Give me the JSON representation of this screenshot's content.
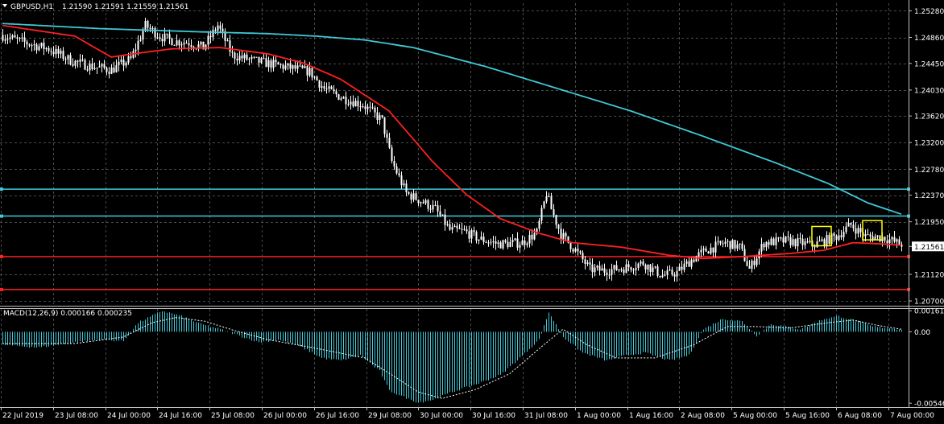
{
  "header": {
    "symbol": "GBPUSD,H1",
    "ohlc": "1.21590 1.21591 1.21559 1.21561"
  },
  "macd_header": "MACD(12,26,9) 0.000166 0.000235",
  "colors": {
    "background": "#000000",
    "grid": "#4a4a4a",
    "candle": "#ffffff",
    "ma_fast": "#ff2020",
    "ma_slow": "#40c8d8",
    "hline_cyan": "#40c8d8",
    "hline_red": "#ff2020",
    "macd_hist": "#40c8d8",
    "macd_signal": "#ffffff",
    "highlight": "#ffff00"
  },
  "chart_data": [
    {
      "type": "candlestick",
      "title": "GBPUSD,H1",
      "price_labels": [
        "1.25280",
        "1.24860",
        "1.24450",
        "1.24030",
        "1.23620",
        "1.23200",
        "1.22780",
        "1.22370",
        "1.21950",
        "1.21561",
        "1.21120",
        "1.20700"
      ],
      "current_price": "1.21561",
      "ylim": [
        1.2065,
        1.254
      ],
      "x_tick_labels": [
        "22 Jul 2019",
        "23 Jul 08:00",
        "24 Jul 00:00",
        "24 Jul 16:00",
        "25 Jul 08:00",
        "26 Jul 00:00",
        "26 Jul 16:00",
        "29 Jul 08:00",
        "30 Jul 00:00",
        "30 Jul 16:00",
        "31 Jul 08:00",
        "1 Aug 00:00",
        "1 Aug 16:00",
        "2 Aug 08:00",
        "5 Aug 00:00",
        "5 Aug 16:00",
        "6 Aug 08:00",
        "7 Aug 00:00"
      ],
      "anchors": [
        [
          0,
          1.249
        ],
        [
          10,
          1.2478
        ],
        [
          20,
          1.2468
        ],
        [
          30,
          1.2448
        ],
        [
          38,
          1.244
        ],
        [
          46,
          1.2435
        ],
        [
          54,
          1.2452
        ],
        [
          60,
          1.2505
        ],
        [
          66,
          1.2488
        ],
        [
          72,
          1.248
        ],
        [
          78,
          1.2478
        ],
        [
          84,
          1.247
        ],
        [
          90,
          1.2505
        ],
        [
          96,
          1.2458
        ],
        [
          104,
          1.245
        ],
        [
          112,
          1.2444
        ],
        [
          120,
          1.2438
        ],
        [
          128,
          1.2432
        ],
        [
          134,
          1.2405
        ],
        [
          142,
          1.239
        ],
        [
          150,
          1.238
        ],
        [
          158,
          1.2355
        ],
        [
          162,
          1.229
        ],
        [
          168,
          1.224
        ],
        [
          174,
          1.2228
        ],
        [
          180,
          1.2215
        ],
        [
          186,
          1.2182
        ],
        [
          192,
          1.218
        ],
        [
          198,
          1.2168
        ],
        [
          206,
          1.216
        ],
        [
          216,
          1.2162
        ],
        [
          222,
          1.2178
        ],
        [
          226,
          1.224
        ],
        [
          228,
          1.2215
        ],
        [
          232,
          1.2175
        ],
        [
          238,
          1.215
        ],
        [
          244,
          1.212
        ],
        [
          250,
          1.2118
        ],
        [
          258,
          1.2122
        ],
        [
          266,
          1.213
        ],
        [
          274,
          1.211
        ],
        [
          280,
          1.2115
        ],
        [
          286,
          1.2135
        ],
        [
          292,
          1.215
        ],
        [
          300,
          1.2162
        ],
        [
          306,
          1.2155
        ],
        [
          310,
          1.212
        ],
        [
          316,
          1.2162
        ],
        [
          326,
          1.2165
        ],
        [
          336,
          1.2158
        ],
        [
          346,
          1.2172
        ],
        [
          352,
          1.219
        ],
        [
          358,
          1.2172
        ],
        [
          366,
          1.217
        ],
        [
          372,
          1.216
        ]
      ],
      "ma_fast": [
        [
          0,
          1.2505
        ],
        [
          30,
          1.2488
        ],
        [
          45,
          1.2455
        ],
        [
          54,
          1.246
        ],
        [
          70,
          1.2468
        ],
        [
          90,
          1.247
        ],
        [
          110,
          1.246
        ],
        [
          125,
          1.2445
        ],
        [
          140,
          1.242
        ],
        [
          160,
          1.237
        ],
        [
          178,
          1.229
        ],
        [
          192,
          1.2238
        ],
        [
          206,
          1.22
        ],
        [
          222,
          1.2177
        ],
        [
          236,
          1.2162
        ],
        [
          256,
          1.2155
        ],
        [
          276,
          1.2142
        ],
        [
          290,
          1.2137
        ],
        [
          306,
          1.214
        ],
        [
          326,
          1.2145
        ],
        [
          340,
          1.215
        ],
        [
          352,
          1.2162
        ],
        [
          364,
          1.216
        ],
        [
          372,
          1.2158
        ]
      ],
      "ma_slow": [
        [
          0,
          1.2508
        ],
        [
          40,
          1.25
        ],
        [
          80,
          1.2495
        ],
        [
          110,
          1.2492
        ],
        [
          130,
          1.2488
        ],
        [
          150,
          1.2482
        ],
        [
          170,
          1.247
        ],
        [
          200,
          1.244
        ],
        [
          230,
          1.2405
        ],
        [
          260,
          1.237
        ],
        [
          290,
          1.233
        ],
        [
          320,
          1.2288
        ],
        [
          342,
          1.2255
        ],
        [
          358,
          1.2225
        ],
        [
          372,
          1.2207
        ]
      ],
      "hlines": [
        {
          "price": 1.22465,
          "color": "cyan"
        },
        {
          "price": 1.2204,
          "color": "cyan"
        },
        {
          "price": 1.214,
          "color": "red"
        },
        {
          "price": 1.2088,
          "color": "red"
        }
      ],
      "highlight_bars": [
        339,
        360
      ]
    },
    {
      "type": "bar",
      "title": "MACD(12,26,9) 0.000166 0.000235",
      "value_labels": [
        "0.001612",
        "0.00",
        "-0.005462"
      ],
      "ylim": [
        -0.0057,
        0.00175
      ],
      "macd": [
        [
          0,
          -0.001
        ],
        [
          15,
          -0.0012
        ],
        [
          30,
          -0.0008
        ],
        [
          40,
          -0.0006
        ],
        [
          50,
          -0.0007
        ],
        [
          56,
          0.0007
        ],
        [
          66,
          0.0016
        ],
        [
          74,
          0.0012
        ],
        [
          82,
          0.0006
        ],
        [
          90,
          0.0002
        ],
        [
          98,
          -0.0003
        ],
        [
          106,
          -0.0008
        ],
        [
          114,
          -0.0006
        ],
        [
          124,
          -0.0012
        ],
        [
          132,
          -0.002
        ],
        [
          140,
          -0.0022
        ],
        [
          148,
          -0.0018
        ],
        [
          156,
          -0.003
        ],
        [
          160,
          -0.0045
        ],
        [
          166,
          -0.005
        ],
        [
          172,
          -0.0054
        ],
        [
          178,
          -0.0052
        ],
        [
          186,
          -0.0046
        ],
        [
          196,
          -0.004
        ],
        [
          206,
          -0.0033
        ],
        [
          214,
          -0.002
        ],
        [
          222,
          -0.0006
        ],
        [
          226,
          0.0015
        ],
        [
          232,
          -0.0004
        ],
        [
          240,
          -0.0016
        ],
        [
          250,
          -0.0022
        ],
        [
          258,
          -0.0018
        ],
        [
          266,
          -0.0016
        ],
        [
          276,
          -0.0022
        ],
        [
          284,
          -0.0018
        ],
        [
          290,
          0.0002
        ],
        [
          298,
          0.001
        ],
        [
          306,
          0.0008
        ],
        [
          312,
          -0.0003
        ],
        [
          318,
          0.0006
        ],
        [
          330,
          0.0002
        ],
        [
          340,
          0.001
        ],
        [
          346,
          0.0012
        ],
        [
          354,
          0.0008
        ],
        [
          360,
          0.0004
        ],
        [
          366,
          0.0003
        ],
        [
          372,
          0.0002
        ]
      ],
      "signal": [
        [
          0,
          -0.0009
        ],
        [
          30,
          -0.0009
        ],
        [
          50,
          -0.0004
        ],
        [
          62,
          0.0007
        ],
        [
          72,
          0.0011
        ],
        [
          84,
          0.0008
        ],
        [
          96,
          0.0001
        ],
        [
          110,
          -0.0006
        ],
        [
          128,
          -0.0012
        ],
        [
          150,
          -0.002
        ],
        [
          162,
          -0.0034
        ],
        [
          172,
          -0.0046
        ],
        [
          182,
          -0.0051
        ],
        [
          196,
          -0.0044
        ],
        [
          210,
          -0.0032
        ],
        [
          224,
          -0.001
        ],
        [
          232,
          0.0002
        ],
        [
          242,
          -0.001
        ],
        [
          254,
          -0.002
        ],
        [
          270,
          -0.002
        ],
        [
          286,
          -0.001
        ],
        [
          300,
          0.0004
        ],
        [
          312,
          0.0004
        ],
        [
          326,
          0.0003
        ],
        [
          342,
          0.0007
        ],
        [
          352,
          0.0009
        ],
        [
          362,
          0.0005
        ],
        [
          372,
          0.0002
        ]
      ]
    }
  ]
}
